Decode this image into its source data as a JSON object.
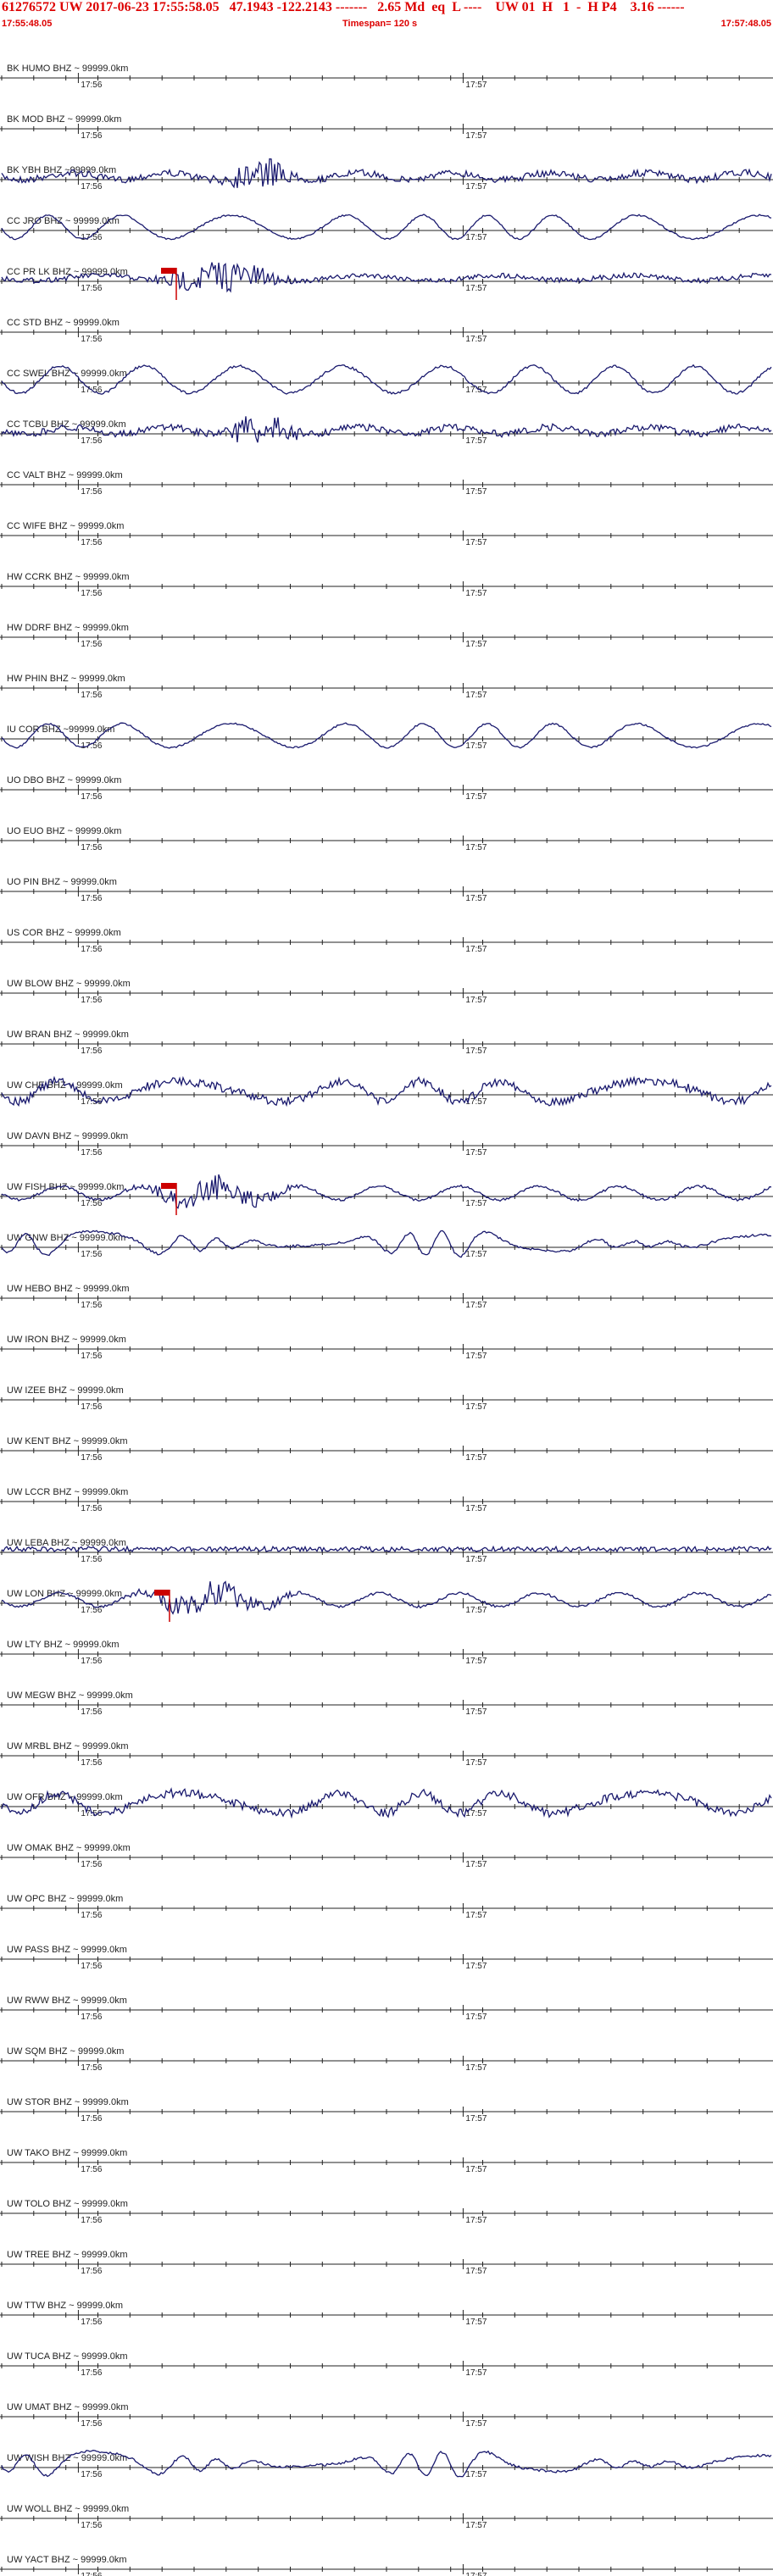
{
  "header": {
    "event_id": "61276572",
    "network": "UW",
    "origin_time": "2017-06-23 17:55:58.05",
    "lat_lon": "47.1943 -122.2143",
    "depth_dashes": "-------",
    "magnitude": "2.65 Md",
    "event_type": "eq",
    "location_type": "L",
    "dashes2": "----",
    "review": "UW 01  H   1  -  H P4",
    "rms": "3.16",
    "dashes3": "------",
    "start_time": "17:55:48.05",
    "timespan": "Timespan= 120 s",
    "end_time": "17:57:48.05"
  },
  "chart_data": {
    "type": "line",
    "title": "61276572 UW 2017-06-23 17:55:58.05",
    "xlim": [
      "17:55:48.05",
      "17:57:48.05"
    ],
    "timespan_s": 120,
    "tick_labels": [
      "17:56",
      "17:57"
    ],
    "colors": {
      "trace": "#1a1a6e",
      "pick": "#cc0000",
      "text": "#222222",
      "header": "#dd0000"
    },
    "channels": [
      {
        "label": "BK HUMO BHZ ~ 99999.0km",
        "trace": "none"
      },
      {
        "label": "BK MOD BHZ ~ 99999.0km",
        "trace": "none"
      },
      {
        "label": "BK YBH BHZ ~99999.0km",
        "trace": "noisy",
        "event": true
      },
      {
        "label": "CC JRO BHZ ~ 99999.0km",
        "trace": "wave"
      },
      {
        "label": "CC PR LK BHZ ~ 99999.0km",
        "trace": "burst",
        "pick": true
      },
      {
        "label": "CC STD BHZ ~ 99999.0km",
        "trace": "none"
      },
      {
        "label": "CC SWEL BHZ ~ 99999.0km",
        "trace": "bigwave"
      },
      {
        "label": "CC TCBU BHZ ~ 99999.0km",
        "trace": "noisy",
        "event": true
      },
      {
        "label": "CC VALT BHZ ~ 99999.0km",
        "trace": "none"
      },
      {
        "label": "CC WIFE BHZ ~ 99999.0km",
        "trace": "none"
      },
      {
        "label": "HW CCRK BHZ ~ 99999.0km",
        "trace": "none"
      },
      {
        "label": "HW DDRF BHZ ~ 99999.0km",
        "trace": "none"
      },
      {
        "label": "HW PHIN BHZ ~ 99999.0km",
        "trace": "none"
      },
      {
        "label": "IU COR BHZ ~99999.0km",
        "trace": "wave"
      },
      {
        "label": "UO DBO BHZ ~ 99999.0km",
        "trace": "none"
      },
      {
        "label": "UO EUO BHZ ~ 99999.0km",
        "trace": "none"
      },
      {
        "label": "UO PIN BHZ ~ 99999.0km",
        "trace": "none"
      },
      {
        "label": "US COR BHZ ~ 99999.0km",
        "trace": "none"
      },
      {
        "label": "UW BLOW BHZ ~ 99999.0km",
        "trace": "none"
      },
      {
        "label": "UW BRAN BHZ ~ 99999.0km",
        "trace": "none"
      },
      {
        "label": "UW CHE BHZ ~ 99999.0km",
        "trace": "noisywave"
      },
      {
        "label": "UW DAVN BHZ ~ 99999.0km",
        "trace": "none"
      },
      {
        "label": "UW FISH BHZ ~ 99999.0km",
        "trace": "eventwave",
        "pick": true
      },
      {
        "label": "UW GNW BHZ ~ 99999.0km",
        "trace": "wave2"
      },
      {
        "label": "UW HEBO BHZ ~ 99999.0km",
        "trace": "none"
      },
      {
        "label": "UW IRON BHZ ~ 99999.0km",
        "trace": "none"
      },
      {
        "label": "UW IZEE BHZ ~ 99999.0km",
        "trace": "none"
      },
      {
        "label": "UW KENT BHZ ~ 99999.0km",
        "trace": "none"
      },
      {
        "label": "UW LCCR BHZ ~ 99999.0km",
        "trace": "none"
      },
      {
        "label": "UW LEBA BHZ ~ 99999.0km",
        "trace": "smallnoise"
      },
      {
        "label": "UW LON BHZ ~ 99999.0km",
        "trace": "eventwave",
        "pick": true
      },
      {
        "label": "UW LTY BHZ ~ 99999.0km",
        "trace": "none"
      },
      {
        "label": "UW MEGW BHZ ~ 99999.0km",
        "trace": "none"
      },
      {
        "label": "UW MRBL BHZ ~ 99999.0km",
        "trace": "none"
      },
      {
        "label": "UW OFR BHZ ~ 99999.0km",
        "trace": "noisywave"
      },
      {
        "label": "UW OMAK BHZ ~ 99999.0km",
        "trace": "none"
      },
      {
        "label": "UW OPC BHZ ~ 99999.0km",
        "trace": "none"
      },
      {
        "label": "UW PASS BHZ ~ 99999.0km",
        "trace": "none"
      },
      {
        "label": "UW RWW BHZ ~ 99999.0km",
        "trace": "none"
      },
      {
        "label": "UW SQM BHZ ~ 99999.0km",
        "trace": "none"
      },
      {
        "label": "UW STOR BHZ ~ 99999.0km",
        "trace": "none"
      },
      {
        "label": "UW TAKO BHZ ~ 99999.0km",
        "trace": "none"
      },
      {
        "label": "UW TOLO BHZ ~ 99999.0km",
        "trace": "none"
      },
      {
        "label": "UW TREE BHZ ~ 99999.0km",
        "trace": "none"
      },
      {
        "label": "UW TTW BHZ ~ 99999.0km",
        "trace": "none"
      },
      {
        "label": "UW TUCA BHZ ~ 99999.0km",
        "trace": "none"
      },
      {
        "label": "UW UMAT BHZ ~ 99999.0km",
        "trace": "none"
      },
      {
        "label": "UW WISH BHZ ~ 99999.0km",
        "trace": "wave2"
      },
      {
        "label": "UW WOLL BHZ ~ 99999.0km",
        "trace": "none"
      },
      {
        "label": "UW YACT BHZ ~ 99999.0km",
        "trace": "none"
      }
    ]
  }
}
